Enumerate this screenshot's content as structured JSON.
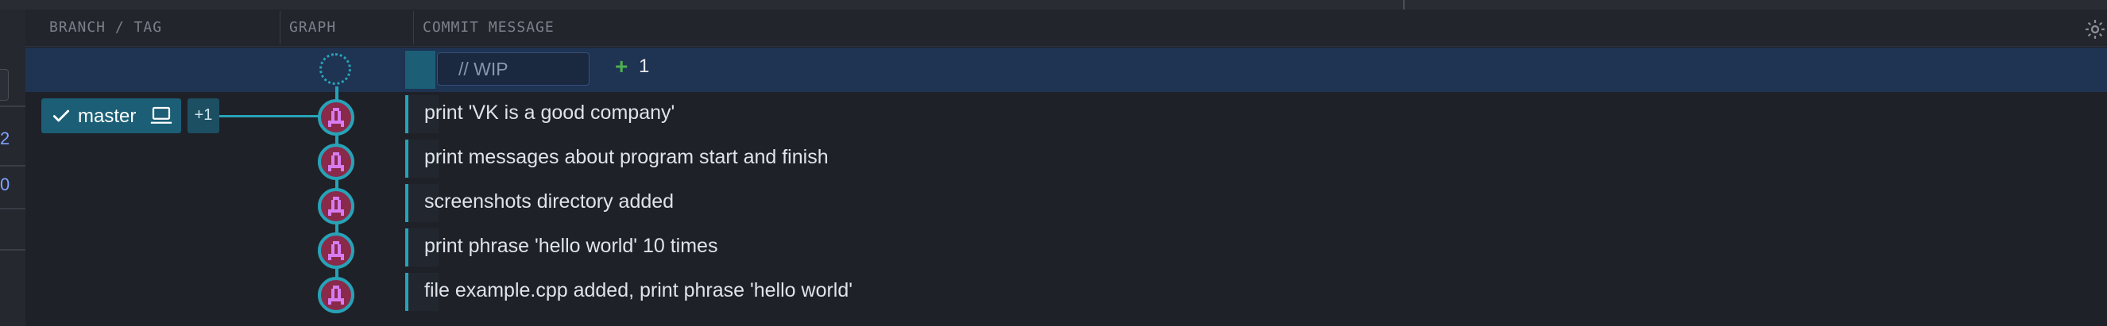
{
  "header": {
    "branch_tag": "BRANCH / TAG",
    "graph": "GRAPH",
    "commit_message": "COMMIT MESSAGE"
  },
  "left_panel": {
    "values": [
      "2",
      "0"
    ]
  },
  "wip": {
    "placeholder": "// WIP",
    "plus_icon": "plus-icon",
    "change_count": "1"
  },
  "branch": {
    "name": "master",
    "extra": "+1",
    "check_icon": "checkmark-icon",
    "local_icon": "laptop-icon"
  },
  "commits": [
    {
      "message": "print 'VK is a good company'"
    },
    {
      "message": "print messages about program start and finish"
    },
    {
      "message": "screenshots directory added"
    },
    {
      "message": "print phrase 'hello world' 10 times"
    },
    {
      "message": "file example.cpp added, print phrase 'hello world'"
    }
  ],
  "colors": {
    "accent": "#27a3b8",
    "wip_row": "#1f3352",
    "branch_bg": "#1b5e76",
    "avatar_bg": "#8a2a4a"
  }
}
